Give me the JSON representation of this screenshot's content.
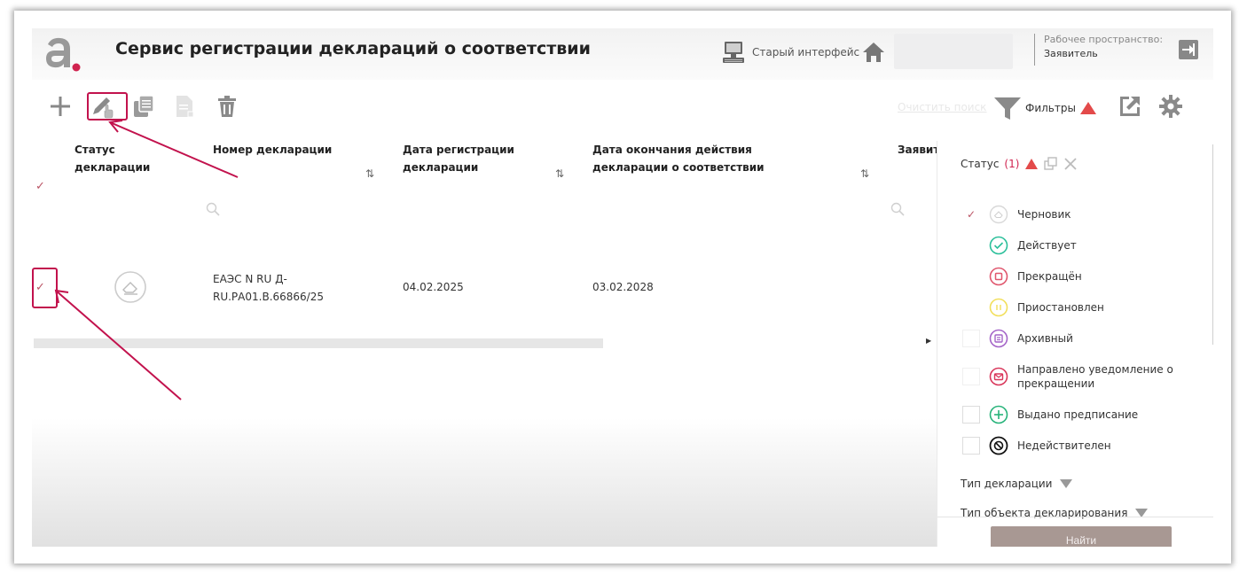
{
  "header": {
    "app_title": "Сервис регистрации деклараций о соответствии",
    "old_interface_label": "Старый интерфейс",
    "workspace_label": "Рабочее пространство:",
    "workspace_value": "Заявитель"
  },
  "toolbar": {
    "clear_search_label": "Очистить поиск",
    "filters_label": "Фильтры"
  },
  "table": {
    "columns": [
      {
        "label": "Статус декларации"
      },
      {
        "label": "Номер декларации"
      },
      {
        "label": "Дата регистрации декларации"
      },
      {
        "label": "Дата окончания действия декларации о соответствии"
      },
      {
        "label": "Заявите"
      }
    ],
    "sort_icon": "⇅",
    "rows": [
      {
        "number": "ЕАЭС N RU Д-RU.РА01.В.66866/25",
        "reg_date": "04.02.2025",
        "end_date": "03.02.2028"
      }
    ]
  },
  "filter_panel": {
    "status_label": "Статус",
    "status_count": "(1)",
    "statuses": [
      {
        "label": "Черновик",
        "checked": true
      },
      {
        "label": "Действует",
        "checked": false
      },
      {
        "label": "Прекращён",
        "checked": false
      },
      {
        "label": "Приостановлен",
        "checked": false
      },
      {
        "label": "Архивный",
        "checked": false
      },
      {
        "label": "Направлено уведомление о прекращении",
        "checked": false
      },
      {
        "label": "Выдано предписание",
        "checked": false
      },
      {
        "label": "Недействителен",
        "checked": false
      }
    ],
    "declaration_type_label": "Тип декларации",
    "object_type_label": "Тип объекта декларирования",
    "find_button_label": "Найти"
  },
  "colors": {
    "accent": "#d0234f",
    "annotation": "#c2124d",
    "active": "#2bbf9a",
    "stopped": "#e0566d",
    "suspended": "#f2df5b",
    "archive": "#a464c8",
    "notice": "#d9365a",
    "prescription": "#27b37a",
    "invalid": "#111111",
    "find_button": "#a89893"
  }
}
